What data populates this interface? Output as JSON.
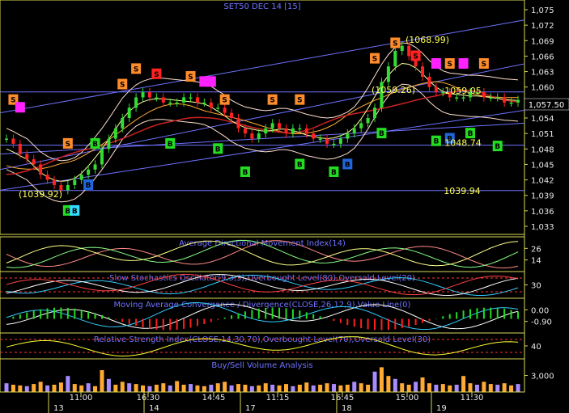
{
  "title": "SET50 DEC 14   [15]",
  "colors": {
    "background": "#000000",
    "bull_candle": "#33dd33",
    "bear_candle": "#ff2222",
    "trend_line": "#6f72ff",
    "panel_border": "#d8d85a",
    "axis_text": "#e8e8e8",
    "buy_signal": "#22dd22",
    "sell_signal": "#ff8c2a",
    "magenta_signal": "#ff22ff",
    "blue_signal": "#2266dd",
    "cyan_signal": "#33ddff",
    "volume_buy": "#ffaa33",
    "volume_sell": "#a78bff",
    "annotation": "#ffff55"
  },
  "price_axis": {
    "ticks": [
      "1,075",
      "1,072",
      "1,069",
      "1,066",
      "1,063",
      "1,060",
      "1,057",
      "1,054",
      "1,051",
      "1,048",
      "1,045",
      "1,042",
      "1,039",
      "1,036",
      "1,033"
    ],
    "last_price_label": "1,057.50"
  },
  "time_axis": {
    "time_labels": [
      "11:00",
      "16:30",
      "14:45",
      "11:15",
      "16:45",
      "15:00",
      "11:30"
    ],
    "day_labels": [
      "13",
      "14",
      "17",
      "18",
      "19"
    ]
  },
  "annotations": [
    "(1068.99)",
    "(1059.26)",
    "1059.05",
    "1048.74",
    "1039.94",
    "(1039.92)"
  ],
  "signal_letters": {
    "buy": "B",
    "sell": "S"
  },
  "panels": [
    {
      "title": "Average Directional Movement Index(14)",
      "axis_labels": [
        "26",
        "14"
      ]
    },
    {
      "title": "Slow Stochastics Oscillator(9,3,3),Overbought Level(80),Oversold Level(20)",
      "axis_labels": [
        "30"
      ]
    },
    {
      "title": "Moving Average Convergence / Divergence(CLOSE,26,12,9),Value Line(0)",
      "axis_labels": [
        "0.00",
        "-0.90"
      ]
    },
    {
      "title": "Relative Strength Index(CLOSE,14,30,70),Overbought Level(70),Oversold Level(30)",
      "axis_labels": [
        "40"
      ]
    },
    {
      "title": "Buy/Sell Volume Analysis",
      "axis_labels": [
        "3,000"
      ]
    }
  ],
  "chart_data": {
    "type": "line",
    "title": "SET50 DEC 14   [15]",
    "y_range": [
      1033,
      1076
    ],
    "series": [
      {
        "values": [
          1050,
          1049,
          1047,
          1046,
          1045,
          1043,
          1042,
          1041,
          1040,
          1041,
          1042,
          1043,
          1044,
          1045,
          1048,
          1050,
          1052,
          1054,
          1056,
          1058,
          1059,
          1058,
          1058,
          1057,
          1057,
          1057,
          1058,
          1058,
          1057,
          1057,
          1056,
          1056,
          1055,
          1054,
          1052,
          1051,
          1050,
          1051,
          1052,
          1053,
          1052,
          1051,
          1052,
          1052,
          1051,
          1050,
          1050,
          1049,
          1049,
          1050,
          1051,
          1052,
          1053,
          1054,
          1056,
          1061,
          1064,
          1067,
          1068,
          1066,
          1064,
          1062,
          1060,
          1059,
          1059,
          1058,
          1058,
          1058,
          1059,
          1059,
          1058,
          1058,
          1058,
          1057,
          1057,
          1057.5
        ]
      }
    ],
    "support_levels": [
      1059.05,
      1048.74,
      1039.94
    ],
    "signals": [
      {
        "type": "S",
        "x": 1,
        "price": 1057.5,
        "color": "orange"
      },
      {
        "type": "M",
        "x": 2,
        "price": 1056,
        "color": "magenta"
      },
      {
        "type": "B",
        "x": 9,
        "price": 1036,
        "color": "green"
      },
      {
        "type": "B",
        "x": 10,
        "price": 1036,
        "color": "cyan"
      },
      {
        "type": "S",
        "x": 9,
        "price": 1049,
        "color": "orange"
      },
      {
        "type": "B",
        "x": 12,
        "price": 1041,
        "color": "blue"
      },
      {
        "type": "B",
        "x": 13,
        "price": 1049,
        "color": "green"
      },
      {
        "type": "S",
        "x": 17,
        "price": 1060.5,
        "color": "orange"
      },
      {
        "type": "S",
        "x": 19,
        "price": 1063.5,
        "color": "orange"
      },
      {
        "type": "S",
        "x": 22,
        "price": 1062.5,
        "color": "red"
      },
      {
        "type": "B",
        "x": 24,
        "price": 1049,
        "color": "green"
      },
      {
        "type": "S",
        "x": 27,
        "price": 1062,
        "color": "orange"
      },
      {
        "type": "M",
        "x": 29,
        "price": 1061,
        "color": "magenta"
      },
      {
        "type": "M",
        "x": 30,
        "price": 1061,
        "color": "magenta"
      },
      {
        "type": "S",
        "x": 32,
        "price": 1057.5,
        "color": "orange"
      },
      {
        "type": "B",
        "x": 31,
        "price": 1048,
        "color": "green"
      },
      {
        "type": "B",
        "x": 35,
        "price": 1043.5,
        "color": "green"
      },
      {
        "type": "S",
        "x": 39,
        "price": 1057.5,
        "color": "orange"
      },
      {
        "type": "B",
        "x": 43,
        "price": 1045,
        "color": "green"
      },
      {
        "type": "S",
        "x": 43,
        "price": 1057.5,
        "color": "orange"
      },
      {
        "type": "B",
        "x": 48,
        "price": 1043.5,
        "color": "green"
      },
      {
        "type": "B",
        "x": 50,
        "price": 1045,
        "color": "blue"
      },
      {
        "type": "S",
        "x": 54,
        "price": 1065.5,
        "color": "orange"
      },
      {
        "type": "B",
        "x": 55,
        "price": 1051,
        "color": "green"
      },
      {
        "type": "S",
        "x": 57,
        "price": 1068.5,
        "color": "orange"
      },
      {
        "type": "S",
        "x": 60,
        "price": 1066,
        "color": "red"
      },
      {
        "type": "M",
        "x": 63,
        "price": 1064.5,
        "color": "magenta"
      },
      {
        "type": "S",
        "x": 65,
        "price": 1064.5,
        "color": "orange"
      },
      {
        "type": "B",
        "x": 63,
        "price": 1049.5,
        "color": "green"
      },
      {
        "type": "B",
        "x": 65,
        "price": 1050,
        "color": "blue"
      },
      {
        "type": "M",
        "x": 67,
        "price": 1064.5,
        "color": "magenta"
      },
      {
        "type": "S",
        "x": 70,
        "price": 1064.5,
        "color": "orange"
      },
      {
        "type": "B",
        "x": 68,
        "price": 1051,
        "color": "green"
      },
      {
        "type": "B",
        "x": 72,
        "price": 1048.5,
        "color": "green"
      }
    ],
    "volume": [
      12,
      10,
      9,
      8,
      11,
      14,
      9,
      10,
      13,
      22,
      11,
      9,
      12,
      8,
      30,
      18,
      10,
      14,
      12,
      11,
      9,
      8,
      10,
      12,
      9,
      15,
      10,
      11,
      9,
      8,
      10,
      12,
      14,
      9,
      11,
      10,
      8,
      9,
      12,
      10,
      9,
      11,
      8,
      10,
      13,
      9,
      10,
      12,
      11,
      9,
      10,
      14,
      12,
      10,
      28,
      34,
      22,
      18,
      12,
      10,
      14,
      20,
      12,
      10,
      11,
      9,
      10,
      22,
      12,
      10,
      14,
      11,
      10,
      12,
      9,
      11
    ]
  }
}
